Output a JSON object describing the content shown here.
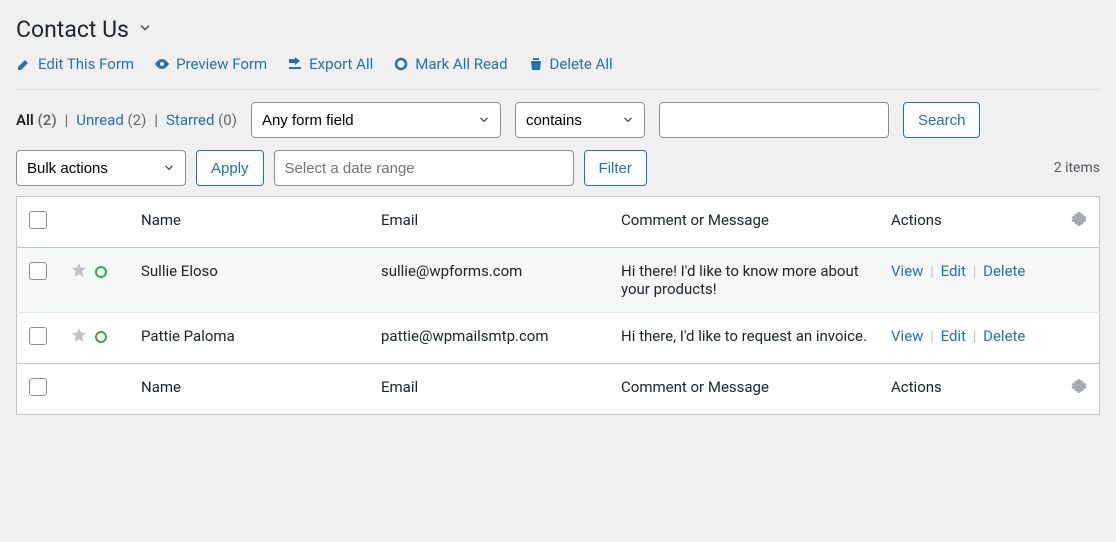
{
  "header": {
    "title": "Contact Us"
  },
  "toolbar": {
    "edit": "Edit This Form",
    "preview": "Preview Form",
    "export": "Export All",
    "mark_read": "Mark All Read",
    "delete_all": "Delete All"
  },
  "status": {
    "all_label": "All",
    "all_count": "(2)",
    "unread_label": "Unread",
    "unread_count": "(2)",
    "starred_label": "Starred",
    "starred_count": "(0)"
  },
  "filters": {
    "field_select": "Any form field",
    "operator_select": "contains",
    "search_button": "Search",
    "bulk_select": "Bulk actions",
    "apply_button": "Apply",
    "date_placeholder": "Select a date range",
    "filter_button": "Filter",
    "items_count": "2 items"
  },
  "columns": {
    "name": "Name",
    "email": "Email",
    "comment": "Comment or Message",
    "actions": "Actions"
  },
  "rows": [
    {
      "name": "Sullie Eloso",
      "email": "sullie@wpforms.com",
      "comment": "Hi there! I'd like to know more about your products!"
    },
    {
      "name": "Pattie Paloma",
      "email": "pattie@wpmailsmtp.com",
      "comment": "Hi there, I'd like to request an invoice."
    }
  ],
  "row_actions": {
    "view": "View",
    "edit": "Edit",
    "delete": "Delete"
  }
}
